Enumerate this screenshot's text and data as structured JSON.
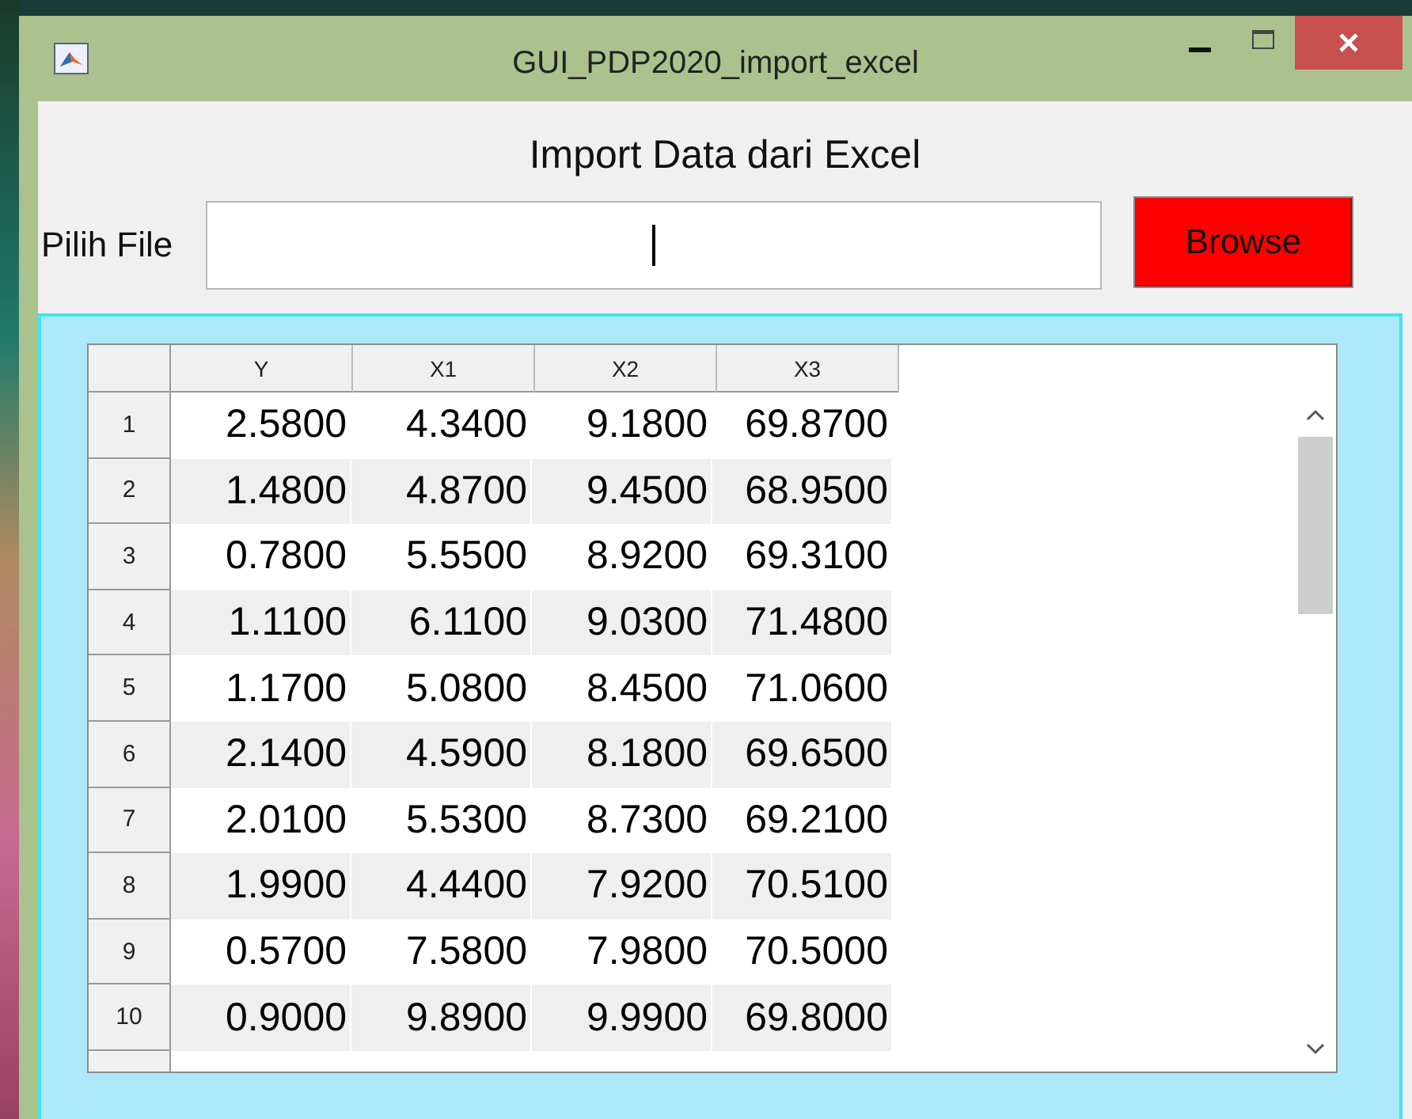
{
  "window": {
    "title": "GUI_PDP2020_import_excel"
  },
  "heading": "Import Data dari Excel",
  "file_picker": {
    "label": "Pilih File",
    "button": "Browse"
  },
  "table": {
    "columns": [
      "Y",
      "X1",
      "X2",
      "X3"
    ],
    "rows": [
      {
        "label": "1",
        "cells": [
          "2.5800",
          "4.3400",
          "9.1800",
          "69.8700"
        ]
      },
      {
        "label": "2",
        "cells": [
          "1.4800",
          "4.8700",
          "9.4500",
          "68.9500"
        ]
      },
      {
        "label": "3",
        "cells": [
          "0.7800",
          "5.5500",
          "8.9200",
          "69.3100"
        ]
      },
      {
        "label": "4",
        "cells": [
          "1.1100",
          "6.1100",
          "9.0300",
          "71.4800"
        ]
      },
      {
        "label": "5",
        "cells": [
          "1.1700",
          "5.0800",
          "8.4500",
          "71.0600"
        ]
      },
      {
        "label": "6",
        "cells": [
          "2.1400",
          "4.5900",
          "8.1800",
          "69.6500"
        ]
      },
      {
        "label": "7",
        "cells": [
          "2.0100",
          "5.5300",
          "8.7300",
          "69.2100"
        ]
      },
      {
        "label": "8",
        "cells": [
          "1.9900",
          "4.4400",
          "7.9200",
          "70.5100"
        ]
      },
      {
        "label": "9",
        "cells": [
          "0.5700",
          "7.5800",
          "7.9800",
          "70.5000"
        ]
      },
      {
        "label": "10",
        "cells": [
          "0.9000",
          "9.8900",
          "9.9900",
          "69.8000"
        ]
      }
    ]
  }
}
